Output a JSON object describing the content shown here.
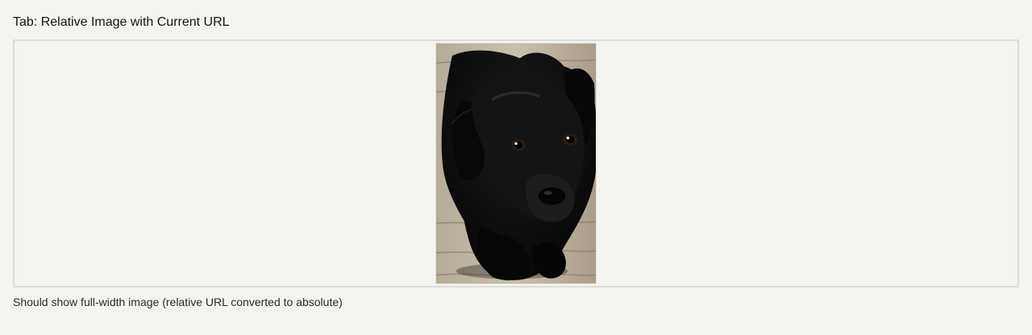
{
  "tab": {
    "title": "Tab: Relative Image with Current URL"
  },
  "content": {
    "caption": "Should show full-width image (relative URL converted to absolute)"
  },
  "image": {
    "subject_icon": "black-puppy-photo"
  }
}
